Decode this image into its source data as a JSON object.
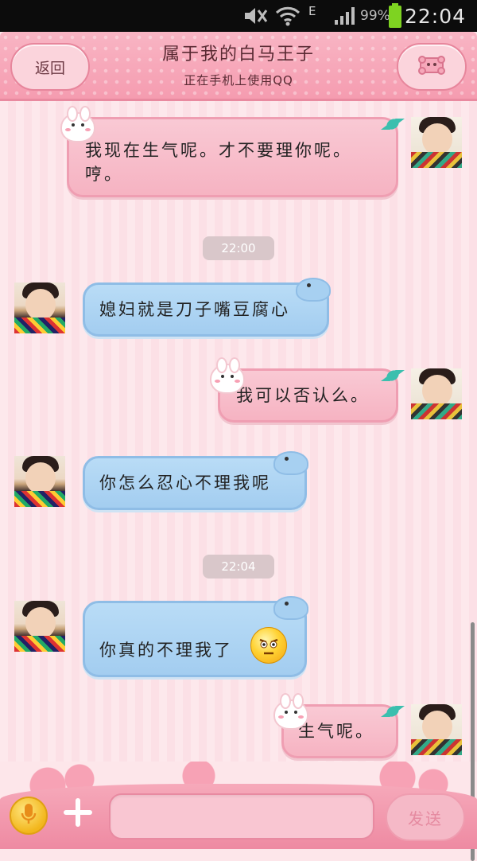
{
  "status_bar": {
    "network": "E",
    "battery": "99%",
    "time": "22:04",
    "icons": [
      "mute-icon",
      "wifi-icon",
      "signal-icon",
      "battery-icon"
    ]
  },
  "header": {
    "back_label": "返回",
    "title": "属于我的白马王子",
    "subtitle": "正在手机上使用QQ",
    "profile_icon": "profile-icon"
  },
  "messages": [
    {
      "side": "right",
      "text": "我现在生气呢。才不要理你呢。哼。"
    },
    {
      "type": "time",
      "text": "22:00"
    },
    {
      "side": "left",
      "text": "媳妇就是刀子嘴豆腐心"
    },
    {
      "side": "right",
      "text": "我可以否认么。"
    },
    {
      "side": "left",
      "text": "你怎么忍心不理我呢"
    },
    {
      "type": "time",
      "text": "22:04"
    },
    {
      "side": "left",
      "text": "你真的不理我了",
      "emoji": "angry-face-emoji"
    },
    {
      "side": "right",
      "text": "生气呢。"
    }
  ],
  "input_bar": {
    "send_label": "发送",
    "input_value": "",
    "mic_icon": "microphone-icon",
    "plus_icon": "plus-icon"
  },
  "colors": {
    "header_pink": "#f59cb0",
    "my_bubble": "#f6b3c2",
    "their_bubble": "#a3cdf0",
    "background": "#fde8ec"
  }
}
